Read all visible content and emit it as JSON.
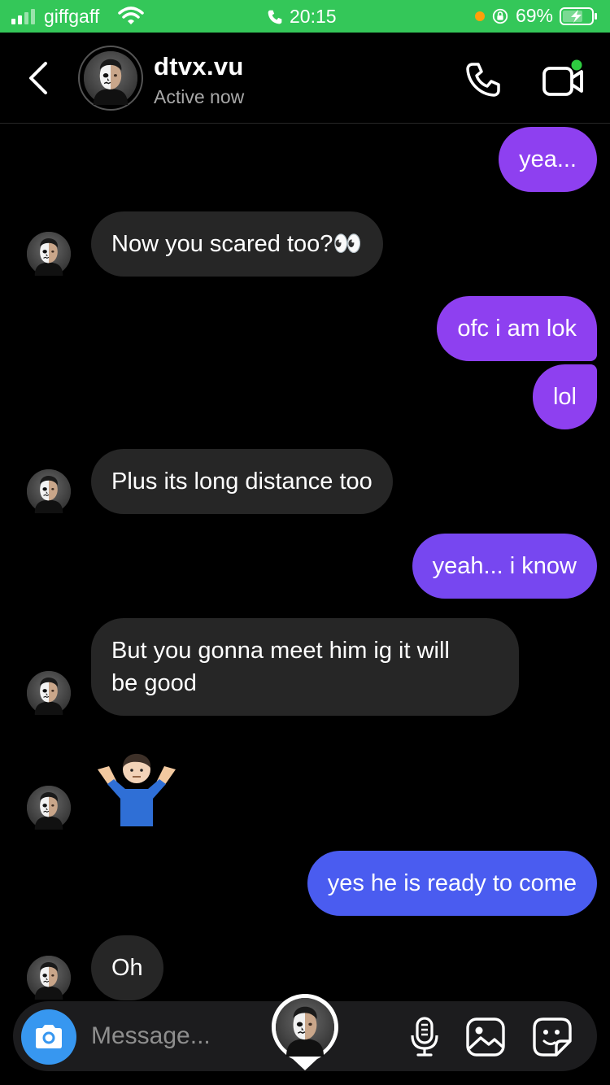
{
  "status_bar": {
    "carrier": "giffgaff",
    "time": "20:15",
    "battery": "69%",
    "background": "#34c759",
    "icons": [
      "signal-icon",
      "wifi-icon",
      "phone-call-icon",
      "orientation-lock-icon",
      "battery-charging-icon"
    ]
  },
  "header": {
    "username": "dtvx.vu",
    "status": "Active now",
    "icons": [
      "back-icon",
      "phone-icon",
      "video-call-icon"
    ],
    "online_dot_color": "#2ecc40"
  },
  "messages": [
    {
      "from": "me",
      "text": "yea..."
    },
    {
      "from": "them",
      "text": "Now you scared too?👀"
    },
    {
      "from": "me",
      "text": "ofc i am lok"
    },
    {
      "from": "me",
      "text": "lol"
    },
    {
      "from": "them",
      "text": "Plus its long distance too"
    },
    {
      "from": "me",
      "text": "yeah... i know"
    },
    {
      "from": "them",
      "text_line1": "But you gonna meet him ig it will",
      "text_line2": "be good"
    },
    {
      "from": "them",
      "emoji": "🤷‍♂️",
      "icon": "man-shrugging-emoji"
    },
    {
      "from": "me",
      "text": "yes he is ready to come"
    },
    {
      "from": "them",
      "text": "Oh"
    }
  ],
  "composer": {
    "placeholder": "Message...",
    "icons": [
      "camera-icon",
      "microphone-icon",
      "gallery-icon",
      "sticker-icon"
    ]
  },
  "colors": {
    "outgoing_purple": "#8e40f0",
    "outgoing_blue": "#4a5cf0",
    "incoming": "#262626",
    "camera_button": "#3797f0"
  }
}
